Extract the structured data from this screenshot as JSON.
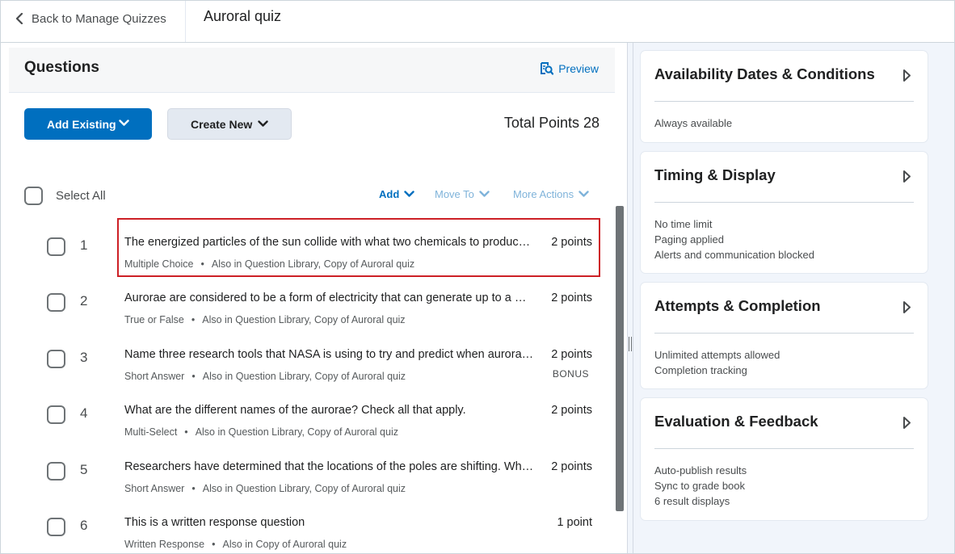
{
  "topbar": {
    "back_label": "Back to Manage Quizzes",
    "quiz_title": "Auroral quiz"
  },
  "questions_panel": {
    "heading": "Questions",
    "preview_label": "Preview",
    "add_existing_label": "Add Existing",
    "create_new_label": "Create New",
    "total_points": "Total Points 28",
    "select_all_label": "Select All",
    "action_add": "Add",
    "action_move_to": "Move To",
    "action_more": "More Actions"
  },
  "questions": [
    {
      "num": "1",
      "text": "The energized particles of the sun collide with what two chemicals to produce the aurora?",
      "type": "Multiple Choice",
      "also_in": "Also in Question Library, Copy of Auroral quiz",
      "points": "2 points",
      "bonus": ""
    },
    {
      "num": "2",
      "text": "Aurorae are considered to be a form of electricity that can generate up to a million amps?",
      "type": "True or False",
      "also_in": "Also in Question Library, Copy of Auroral quiz",
      "points": "2 points",
      "bonus": ""
    },
    {
      "num": "3",
      "text": "Name three research tools that NASA is using to try and predict when aurorae will occur.",
      "type": "Short Answer",
      "also_in": "Also in Question Library, Copy of Auroral quiz",
      "points": "2 points",
      "bonus": "BONUS"
    },
    {
      "num": "4",
      "text": "What are the different names of the aurorae? Check all that apply.",
      "type": "Multi-Select",
      "also_in": "Also in Question Library, Copy of Auroral quiz",
      "points": "2 points",
      "bonus": ""
    },
    {
      "num": "5",
      "text": "Researchers have determined that the locations of the poles are shifting. What does this mean for the aurorae?",
      "type": "Short Answer",
      "also_in": "Also in Question Library, Copy of Auroral quiz",
      "points": "2 points",
      "bonus": ""
    },
    {
      "num": "6",
      "text": "This is a written response question",
      "type": "Written Response",
      "also_in": "Also in Copy of Auroral quiz",
      "points": "1 point",
      "bonus": ""
    }
  ],
  "settings_cards": [
    {
      "title": "Availability Dates & Conditions",
      "lines": [
        "Always available"
      ]
    },
    {
      "title": "Timing & Display",
      "lines": [
        "No time limit",
        "Paging applied",
        "Alerts and communication blocked"
      ]
    },
    {
      "title": "Attempts & Completion",
      "lines": [
        "Unlimited attempts allowed",
        "Completion tracking"
      ]
    },
    {
      "title": "Evaluation & Feedback",
      "lines": [
        "Auto-publish results",
        "Sync to grade book",
        "6 result displays"
      ]
    }
  ],
  "colors": {
    "primary": "#006fbf",
    "highlight_border": "#cd2026",
    "panel_bg": "#f1f5fb"
  },
  "icons": [
    "chevron-left-icon",
    "preview-icon",
    "chevron-down-icon",
    "triangle-right-icon",
    "splitter-grip-icon"
  ]
}
